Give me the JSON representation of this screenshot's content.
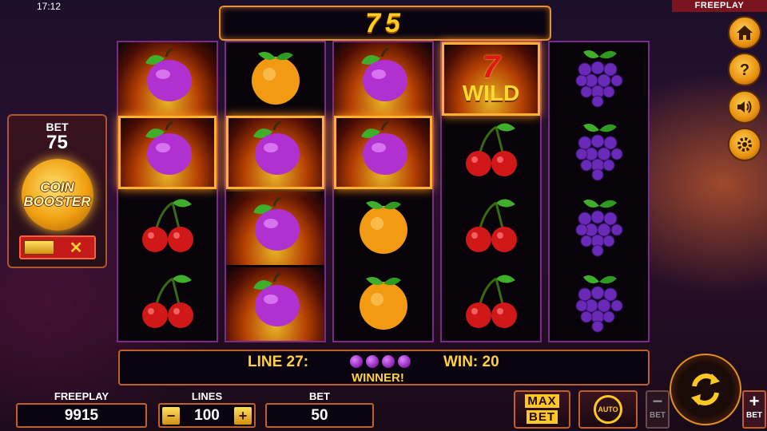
{
  "status": {
    "time": "17:12",
    "mode_tag": "FREEPLAY"
  },
  "win_display": "75",
  "bet_panel": {
    "label": "BET",
    "value": "75",
    "booster_line1": "COIN",
    "booster_line2": "BOOSTER",
    "toggle_off_symbol": "✕"
  },
  "reels": [
    [
      {
        "symbol": "plum",
        "fire": true,
        "highlight": false
      },
      {
        "symbol": "plum",
        "fire": true,
        "highlight": true
      },
      {
        "symbol": "cherry",
        "fire": false,
        "highlight": false
      },
      {
        "symbol": "cherry",
        "fire": false,
        "highlight": false
      }
    ],
    [
      {
        "symbol": "orange",
        "fire": false,
        "highlight": false
      },
      {
        "symbol": "plum",
        "fire": true,
        "highlight": true
      },
      {
        "symbol": "plum",
        "fire": true,
        "highlight": false
      },
      {
        "symbol": "plum",
        "fire": true,
        "highlight": false
      }
    ],
    [
      {
        "symbol": "plum",
        "fire": true,
        "highlight": false
      },
      {
        "symbol": "plum",
        "fire": true,
        "highlight": true
      },
      {
        "symbol": "orange",
        "fire": false,
        "highlight": false
      },
      {
        "symbol": "orange",
        "fire": false,
        "highlight": false
      }
    ],
    [
      {
        "symbol": "wild",
        "fire": true,
        "highlight": true,
        "label": "WILD",
        "seven": "7"
      },
      {
        "symbol": "cherry",
        "fire": false,
        "highlight": false
      },
      {
        "symbol": "cherry",
        "fire": false,
        "highlight": false
      },
      {
        "symbol": "cherry",
        "fire": false,
        "highlight": false
      }
    ],
    [
      {
        "symbol": "grapes",
        "fire": false,
        "highlight": false
      },
      {
        "symbol": "grapes",
        "fire": false,
        "highlight": false
      },
      {
        "symbol": "grapes",
        "fire": false,
        "highlight": false
      },
      {
        "symbol": "grapes",
        "fire": false,
        "highlight": false
      }
    ]
  ],
  "side_buttons": [
    "home-icon",
    "help-icon",
    "sound-icon",
    "settings-icon"
  ],
  "line_info": {
    "line": "LINE 27:",
    "win": "WIN: 20",
    "winner": "WINNER!",
    "mini_symbols": 4
  },
  "footer": {
    "freeplay_label": "FREEPLAY",
    "freeplay_value": "9915",
    "lines_label": "LINES",
    "lines_value": "100",
    "minus": "−",
    "plus": "+",
    "bet_label": "BET",
    "bet_value": "50",
    "max_line1": "MAX",
    "max_line2": "BET",
    "auto_label": "AUTO",
    "bet_minus_label": "BET",
    "bet_plus_label": "BET"
  },
  "colors": {
    "accent": "#ffc820",
    "frame": "#c06028",
    "reel_border": "#7b2a8a"
  }
}
